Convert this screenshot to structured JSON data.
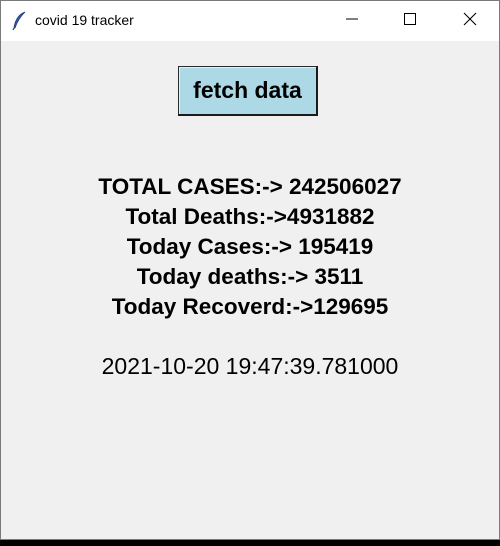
{
  "window": {
    "title": "covid 19 tracker",
    "icon": "feather-icon",
    "controls": [
      "minimize-icon",
      "maximize-icon",
      "close-icon"
    ]
  },
  "toolbar": {
    "fetch_label": "fetch data",
    "fetch_bg": "#add8e6"
  },
  "stats": {
    "total_cases": "TOTAL CASES:-> 242506027",
    "total_deaths": "Total Deaths:->4931882",
    "today_cases": "Today Cases:-> 195419",
    "today_deaths": "Today deaths:-> 3511",
    "today_recovered": "Today Recoverd:->129695"
  },
  "timestamp": "2021-10-20 19:47:39.781000"
}
